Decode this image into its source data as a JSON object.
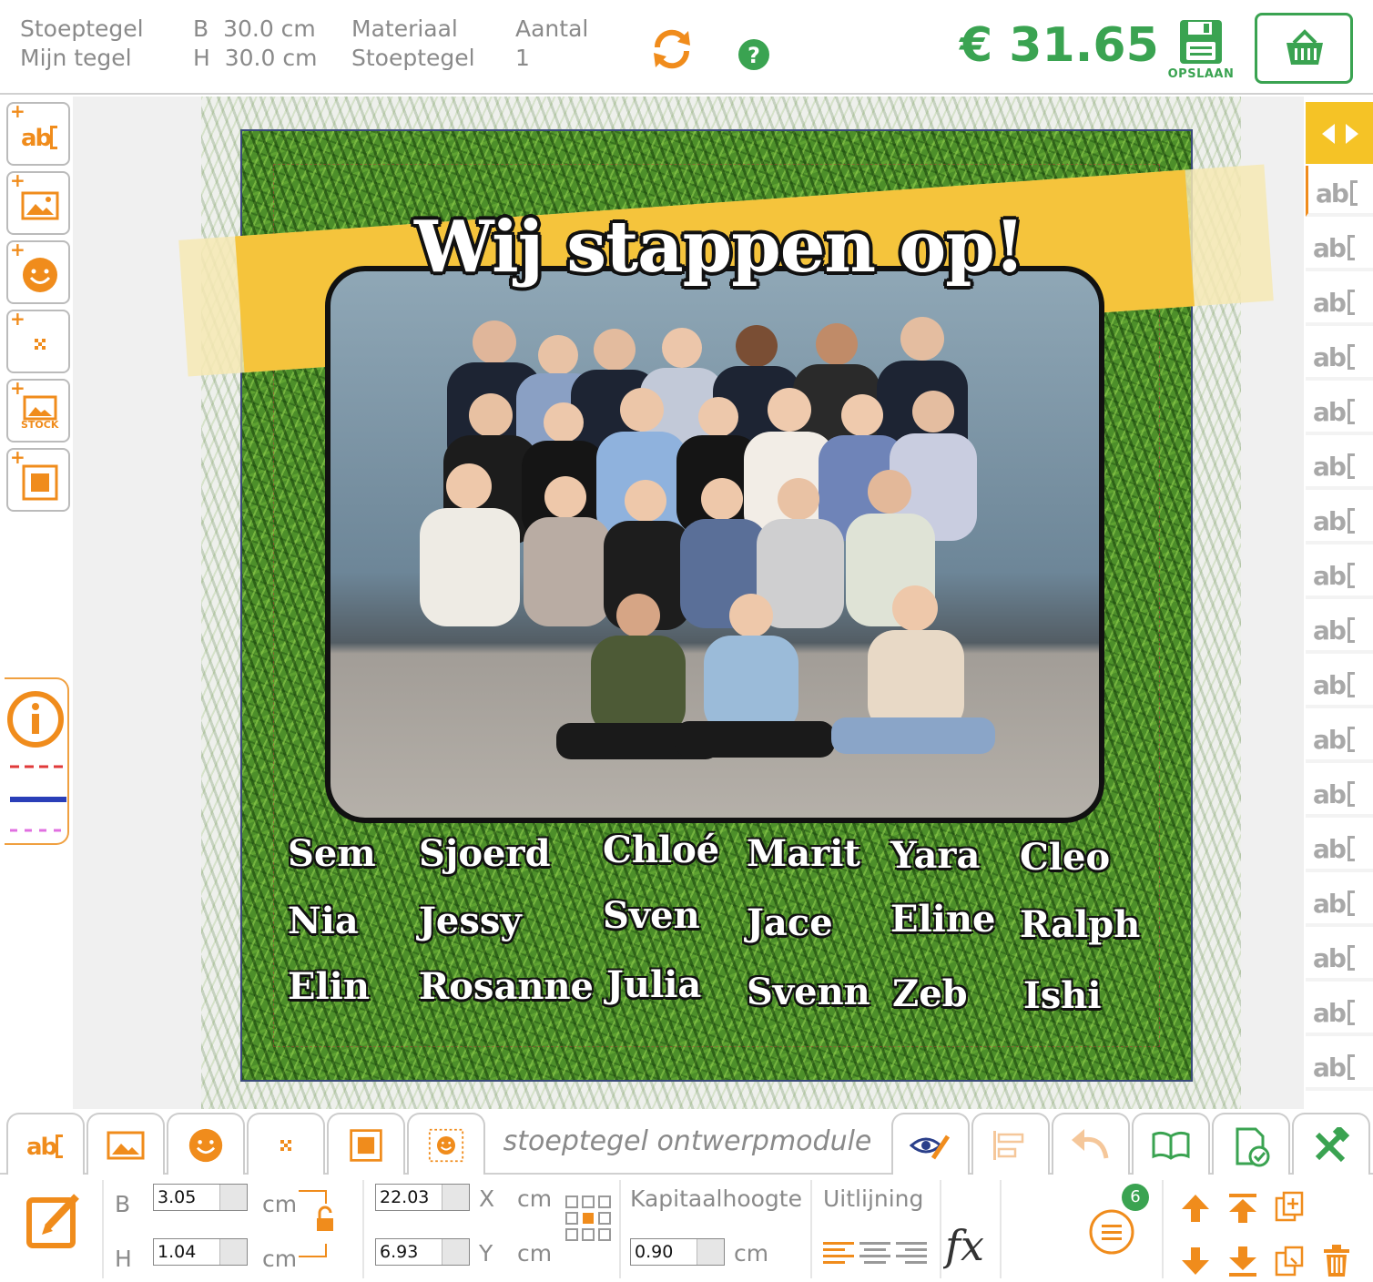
{
  "header": {
    "product_type": "Stoeptegel",
    "product_name": "Mijn tegel",
    "width_label": "B",
    "width_value": "30.0 cm",
    "height_label": "H",
    "height_value": "30.0 cm",
    "material_label": "Materiaal",
    "material_value": "Stoeptegel",
    "quantity_label": "Aantal",
    "quantity_value": "1",
    "price": "€ 31.65",
    "save_label": "OPSLAAN"
  },
  "left_toolbar": {
    "tools": [
      {
        "name": "add-text",
        "icon": "text-field-icon"
      },
      {
        "name": "add-image",
        "icon": "image-icon"
      },
      {
        "name": "add-emoji",
        "icon": "smiley-icon"
      },
      {
        "name": "add-qr",
        "icon": "qr-icon"
      },
      {
        "name": "add-stock",
        "icon": "stock-image-icon",
        "label": "STOCK"
      },
      {
        "name": "add-shape",
        "icon": "square-shape-icon"
      }
    ]
  },
  "right_panel": {
    "layer_icon": "text-field-icon",
    "layer_count": 17
  },
  "canvas": {
    "title": "Wij stappen op!",
    "names": [
      "Sem",
      "Sjoerd",
      "Chloé",
      "Marit",
      "Yara",
      "Cleo",
      "Nia",
      "Jessy",
      "Sven",
      "Jace",
      "Eline",
      "Ralph",
      "Elin",
      "Rosanne",
      "Julia",
      "Svenn",
      "Zeb",
      "Ishi"
    ]
  },
  "tabs": {
    "title": "stoeptegel ontwerpmodule"
  },
  "properties": {
    "b_label": "B",
    "h_label": "H",
    "width": "3.05",
    "height": "1.04",
    "unit": "cm",
    "x_label": "X",
    "y_label": "Y",
    "x": "22.03",
    "y": "6.93",
    "cap_height_label": "Kapitaalhoogte",
    "cap_height": "0.90",
    "align_label": "Uitlijning",
    "layers_badge": "6"
  },
  "colors": {
    "accent": "#f08c1c",
    "green": "#3aa351",
    "banner": "#f5c43c"
  }
}
